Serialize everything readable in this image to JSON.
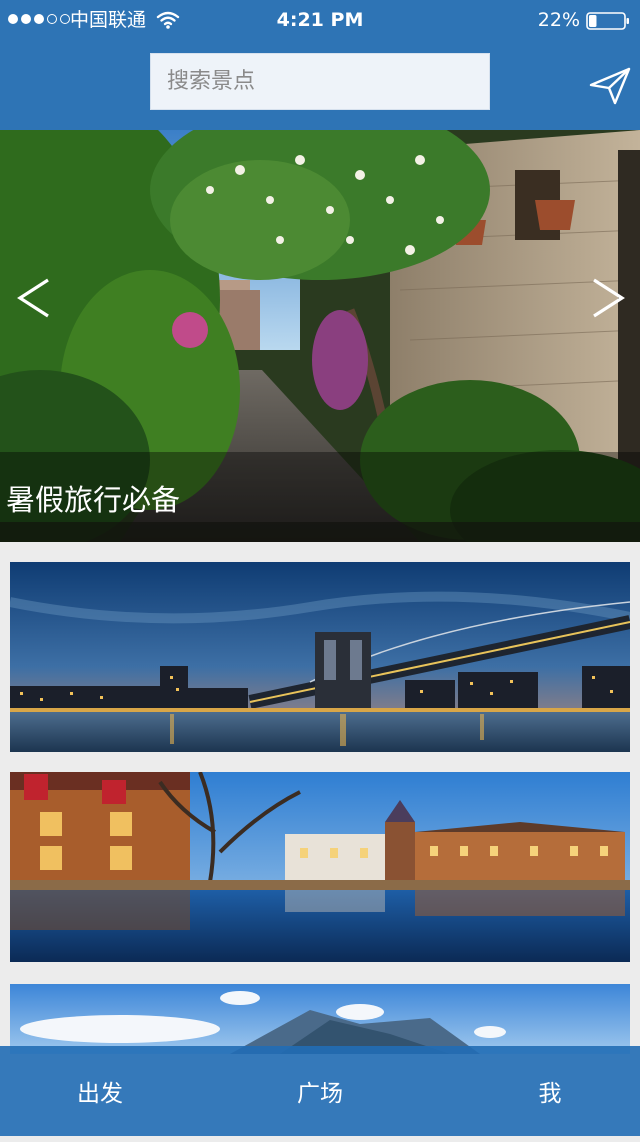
{
  "status_bar": {
    "carrier": "中国联通",
    "time": "4:21 PM",
    "battery": "22%",
    "battery_level": 0.22,
    "signal_bars_filled": 3,
    "signal_bars_total": 5,
    "icons": [
      "signal-dots",
      "wifi-icon",
      "battery-icon"
    ]
  },
  "search": {
    "placeholder": "搜索景点",
    "value": ""
  },
  "header": {
    "send_icon": "paper-plane-icon",
    "background_color": "#2e74b5"
  },
  "hero": {
    "caption": "暑假旅行必备",
    "prev_arrow": "<",
    "next_arrow": ">"
  },
  "cards": [
    {
      "subject": "city-bridge-night"
    },
    {
      "subject": "lakeside-town-reflection"
    },
    {
      "subject": "mountain-lake"
    }
  ],
  "tab_bar": {
    "tabs": [
      {
        "label": "出发"
      },
      {
        "label": "广场"
      },
      {
        "label": "我"
      }
    ],
    "background_color": "#216db5"
  }
}
